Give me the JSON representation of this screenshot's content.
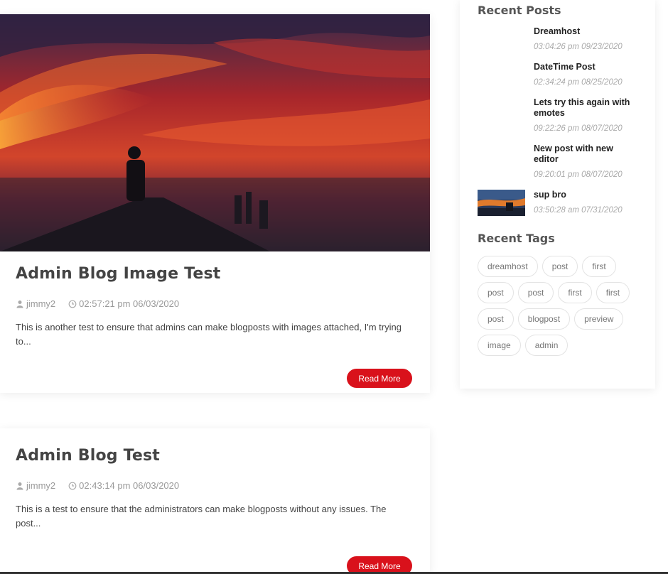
{
  "posts": [
    {
      "title": "Admin Blog Image Test",
      "author": "jimmy2",
      "datetime": "02:57:21 pm 06/03/2020",
      "excerpt": "This is another test to ensure that admins can make blogposts with images attached, I'm trying to...",
      "read_more": "Read More"
    },
    {
      "title": "Admin Blog Test",
      "author": "jimmy2",
      "datetime": "02:43:14 pm 06/03/2020",
      "excerpt": "This is a test to ensure that the administrators can make blogposts without any issues. The post...",
      "read_more": "Read More"
    }
  ],
  "sidebar": {
    "recent_posts_title": "Recent Posts",
    "recent_posts": [
      {
        "title": "Dreamhost",
        "date": "03:04:26 pm 09/23/2020"
      },
      {
        "title": "DateTime Post",
        "date": "02:34:24 pm 08/25/2020"
      },
      {
        "title": "Lets try this again with emotes",
        "date": "09:22:26 pm 08/07/2020"
      },
      {
        "title": "New post with new editor",
        "date": "09:20:01 pm 08/07/2020"
      },
      {
        "title": "sup bro",
        "date": "03:50:28 am 07/31/2020"
      }
    ],
    "recent_tags_title": "Recent Tags",
    "tags": [
      "dreamhost",
      "post",
      "first",
      "post",
      "post",
      "first",
      "first",
      "post",
      "blogpost",
      "preview",
      "image",
      "admin"
    ]
  },
  "colors": {
    "accent": "#d9111b"
  },
  "icons": {
    "author": "user-icon",
    "time": "clock-icon"
  }
}
